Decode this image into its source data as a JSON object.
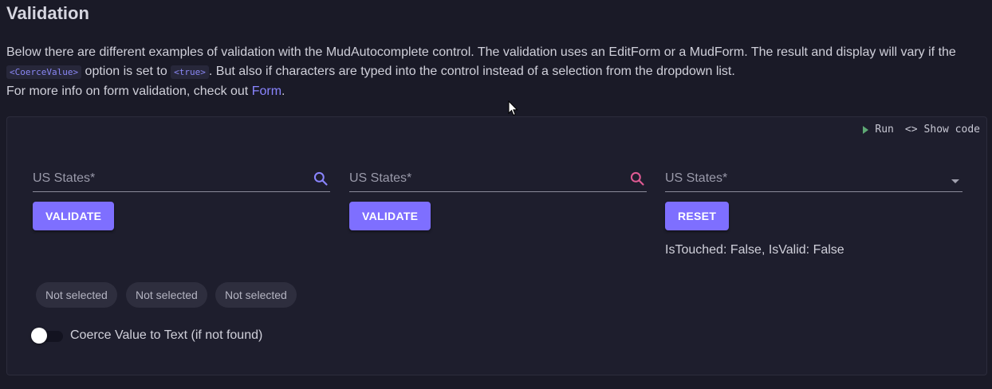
{
  "page": {
    "title": "Validation",
    "desc_part1": "Below there are different examples of validation with the MudAutocomplete control. The validation uses an EditForm or a MudForm. The result and display will vary if the ",
    "code1": "<CoerceValue>",
    "desc_part2": " option is set to ",
    "code2": "<true>",
    "desc_part3": ". But also if characters are typed into the control instead of a selection from the dropdown list.",
    "info_prefix": "For more info on form validation, check out ",
    "info_link": "Form",
    "info_suffix": "."
  },
  "toolbar": {
    "run_label": "Run",
    "show_code_label": "Show code"
  },
  "fields": [
    {
      "label": "US States*",
      "icon": "search-icon",
      "icon_color": "#8a85ff"
    },
    {
      "label": "US States*",
      "icon": "search-icon",
      "icon_color": "#e05a93"
    },
    {
      "label": "US States*",
      "icon": "arrow-drop-down-icon",
      "icon_color": "#a0a0ae"
    }
  ],
  "buttons": {
    "validate1": "VALIDATE",
    "validate2": "VALIDATE",
    "reset": "RESET"
  },
  "status_text": "IsTouched: False, IsValid: False",
  "chips": [
    "Not selected",
    "Not selected",
    "Not selected"
  ],
  "switch": {
    "label": "Coerce Value to Text (if not found)",
    "checked": false
  },
  "colors": {
    "accent": "#7e6fff",
    "background": "#1a1a27",
    "card": "#1e1e2d"
  }
}
